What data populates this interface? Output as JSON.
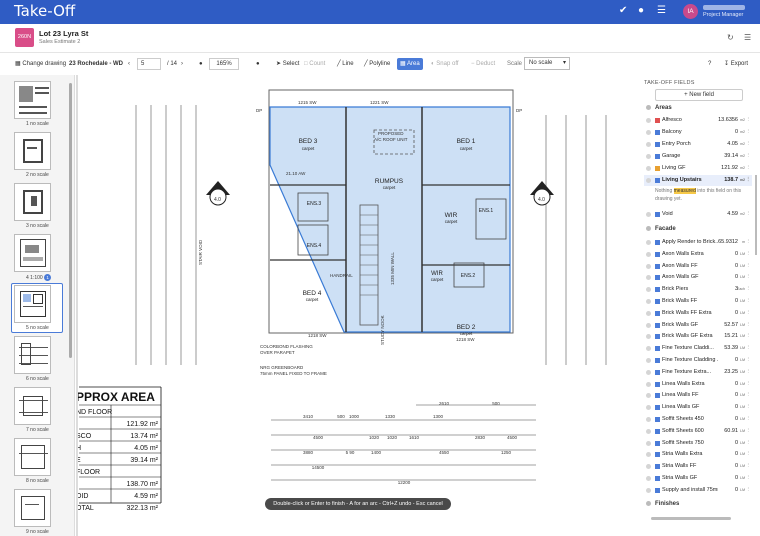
{
  "app": {
    "title": "Take-Off"
  },
  "user": {
    "initials": "IA",
    "role": "Project Manager"
  },
  "project": {
    "badge": "260N",
    "name": "Lot 23 Lyra St",
    "subtitle": "Sales Estimate 2"
  },
  "toolbar": {
    "change_drawing": "Change drawing",
    "drawing_name": "23 Rochedale - WD",
    "page_current": "5",
    "page_total": "/ 14",
    "zoom": "165%",
    "select": "Select",
    "count": "Count",
    "line": "Line",
    "polyline": "Polyline",
    "area": "Area",
    "snap": "Snap off",
    "deduct": "Deduct",
    "scale_label": "Scale",
    "scale_value": "No scale",
    "help": "?",
    "export": "Export"
  },
  "thumbnails": [
    {
      "label": "1 no scale"
    },
    {
      "label": "2 no scale"
    },
    {
      "label": "3 no scale"
    },
    {
      "label": "4 1:100",
      "badge": "1"
    },
    {
      "label": "5 no scale"
    },
    {
      "label": "6 no scale"
    },
    {
      "label": "7 no scale"
    },
    {
      "label": "8 no scale"
    },
    {
      "label": "9 no scale"
    }
  ],
  "drawing": {
    "rooms": [
      {
        "name": "BED 3",
        "sub": "carpet"
      },
      {
        "name": "BED 1",
        "sub": "carpet"
      },
      {
        "name": "RUMPUS",
        "sub": "carpet"
      },
      {
        "name": "WIR",
        "sub": "carpet"
      },
      {
        "name": "ENS.3",
        "sub": ""
      },
      {
        "name": "ENS.4",
        "sub": ""
      },
      {
        "name": "ENS.1",
        "sub": ""
      },
      {
        "name": "ENS.2",
        "sub": ""
      },
      {
        "name": "WIR",
        "sub": "carpet"
      },
      {
        "name": "BED 4",
        "sub": "carpet"
      },
      {
        "name": "BED 2",
        "sub": "carpet"
      }
    ],
    "notes": [
      "PROPOSED",
      "A/C ROOF UNIT",
      "HANDRAIL",
      "STUDY NOOK",
      "COLORBOND FLASHING",
      "OVER PARAPET",
      "NRG GREENBOARD",
      "75mm PANEL FIXED TO FRAME",
      "1215 SW",
      "1221 SW",
      "1218 SW",
      "1218 SW",
      "21.10 AW",
      "STAIR VOID",
      "1335 MIN WALL",
      "DP",
      "DP",
      "4.0",
      "4.0"
    ],
    "dims_top": [
      "3410",
      "500",
      "1000",
      "1330",
      "1300",
      "2610",
      "500"
    ],
    "dims_mid": [
      "4500",
      "1020",
      "1020",
      "1610",
      "2830",
      "4500"
    ],
    "dims_low": [
      "3880",
      "5 90",
      "1400",
      "4550",
      "1250"
    ],
    "dims_total": [
      "14500",
      "12200"
    ],
    "schedule": {
      "title": "PPROX AREA",
      "rows": [
        {
          "name": "ND FLOOR",
          "value": ""
        },
        {
          "name": "",
          "value": "121.92 m²"
        },
        {
          "name": "SCO",
          "value": "13.74 m²"
        },
        {
          "name": "H",
          "value": "4.05 m²"
        },
        {
          "name": "E",
          "value": "39.14 m²"
        },
        {
          "name": "FLOOR",
          "value": ""
        },
        {
          "name": "",
          "value": "138.70 m²"
        },
        {
          "name": "OID",
          "value": "4.59 m²"
        },
        {
          "name": "OTAL",
          "value": "322.13 m²"
        }
      ]
    }
  },
  "hint": "Double-click or Enter to finish - A for an arc - Ctrl+Z undo - Esc cancel",
  "panel": {
    "title": "TAKE-OFF FIELDS",
    "new_field": "New field",
    "groups": [
      {
        "name": "Areas"
      },
      {
        "name": "Facade"
      },
      {
        "name": "Finishes"
      }
    ],
    "areas": [
      {
        "name": "Alfresco",
        "qty": "13.6356",
        "unit": "m2",
        "color": "#e05050"
      },
      {
        "name": "Balcony",
        "qty": "0",
        "unit": "m2",
        "color": "#4a7bd8"
      },
      {
        "name": "Entry Porch",
        "qty": "4.05",
        "unit": "m2",
        "color": "#4a7bd8"
      },
      {
        "name": "Garage",
        "qty": "39.14",
        "unit": "m2",
        "color": "#4a7bd8"
      },
      {
        "name": "Living GF",
        "qty": "121.92",
        "unit": "m2",
        "color": "#e8a030"
      },
      {
        "name": "Living Upstairs",
        "qty": "138.7",
        "unit": "m2",
        "color": "#4a7bd8"
      }
    ],
    "note_pre": "Nothing ",
    "note_hl": "measured",
    "note_post": " into this field on this drawing yet.",
    "void": {
      "name": "Void",
      "qty": "4.59",
      "unit": "m2",
      "color": "#4a7bd8"
    },
    "facade": [
      {
        "name": "Apply Render to Brick...",
        "qty": "65.9312",
        "unit": "m"
      },
      {
        "name": "Axon Walls Extra",
        "qty": "0",
        "unit": "LM"
      },
      {
        "name": "Axon Walls FF",
        "qty": "0",
        "unit": "LM"
      },
      {
        "name": "Axon Walls GF",
        "qty": "0",
        "unit": "LM"
      },
      {
        "name": "Brick Piers",
        "qty": "3",
        "unit": "Each"
      },
      {
        "name": "Brick Walls FF",
        "qty": "0",
        "unit": "LM"
      },
      {
        "name": "Brick Walls FF Extra",
        "qty": "0",
        "unit": "LM"
      },
      {
        "name": "Brick Walls GF",
        "qty": "52.57",
        "unit": "LM"
      },
      {
        "name": "Brick Walls GF Extra",
        "qty": "15.21",
        "unit": "LM"
      },
      {
        "name": "Fine Texture Claddi...",
        "qty": "53.39",
        "unit": "LM"
      },
      {
        "name": "Fine Texture Cladding ...",
        "qty": "0",
        "unit": "LM"
      },
      {
        "name": "Fine Texture Extra...",
        "qty": "23.25",
        "unit": "LM"
      },
      {
        "name": "Linea Walls Extra",
        "qty": "0",
        "unit": "LM"
      },
      {
        "name": "Linea Walls FF",
        "qty": "0",
        "unit": "LM"
      },
      {
        "name": "Linea Walls GF",
        "qty": "0",
        "unit": "LM"
      },
      {
        "name": "Soffit Sheets 450",
        "qty": "0",
        "unit": "LM"
      },
      {
        "name": "Soffit Sheets 600",
        "qty": "60.91",
        "unit": "LM"
      },
      {
        "name": "Soffit Sheets 750",
        "qty": "0",
        "unit": "LM"
      },
      {
        "name": "Stria Walls Extra",
        "qty": "0",
        "unit": "LM"
      },
      {
        "name": "Stria Walls FF",
        "qty": "0",
        "unit": "LM"
      },
      {
        "name": "Stria Walls GF",
        "qty": "0",
        "unit": "LM"
      },
      {
        "name": "Supply and install 75mm EP...",
        "qty": "0",
        "unit": "LM"
      }
    ]
  }
}
